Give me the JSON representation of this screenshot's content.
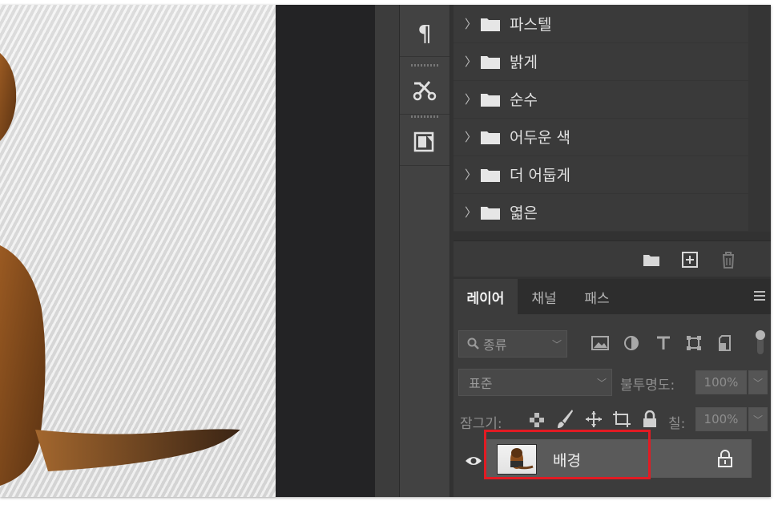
{
  "tool_strip": {
    "icons": [
      "paragraph-icon",
      "tools-scissors-icon",
      "properties-panel-icon"
    ],
    "paragraph_glyph": "¶"
  },
  "swatches": {
    "folders": [
      {
        "label": "파스텔"
      },
      {
        "label": "밝게"
      },
      {
        "label": "순수"
      },
      {
        "label": "어두운 색"
      },
      {
        "label": "더 어둡게"
      },
      {
        "label": "엷은"
      }
    ]
  },
  "layers_panel": {
    "tabs": [
      {
        "label": "레이어",
        "active": true
      },
      {
        "label": "채널",
        "active": false
      },
      {
        "label": "패스",
        "active": false
      }
    ],
    "filter_placeholder": "종류",
    "filter_icons": [
      "image-filter-icon",
      "adjustment-filter-icon",
      "type-filter-icon",
      "shape-filter-icon",
      "smart-object-filter-icon"
    ],
    "blend_mode": "표준",
    "opacity_label": "불투명도:",
    "opacity_value": "100%",
    "lock_label": "잠그기:",
    "fill_label": "칠:",
    "fill_value": "100%",
    "layer": {
      "name": "배경",
      "visible": true,
      "locked": true
    }
  },
  "colors": {
    "highlight": "#e21b23",
    "panel_bg": "#3c3c3c",
    "selected_layer": "#5a5a5a"
  }
}
